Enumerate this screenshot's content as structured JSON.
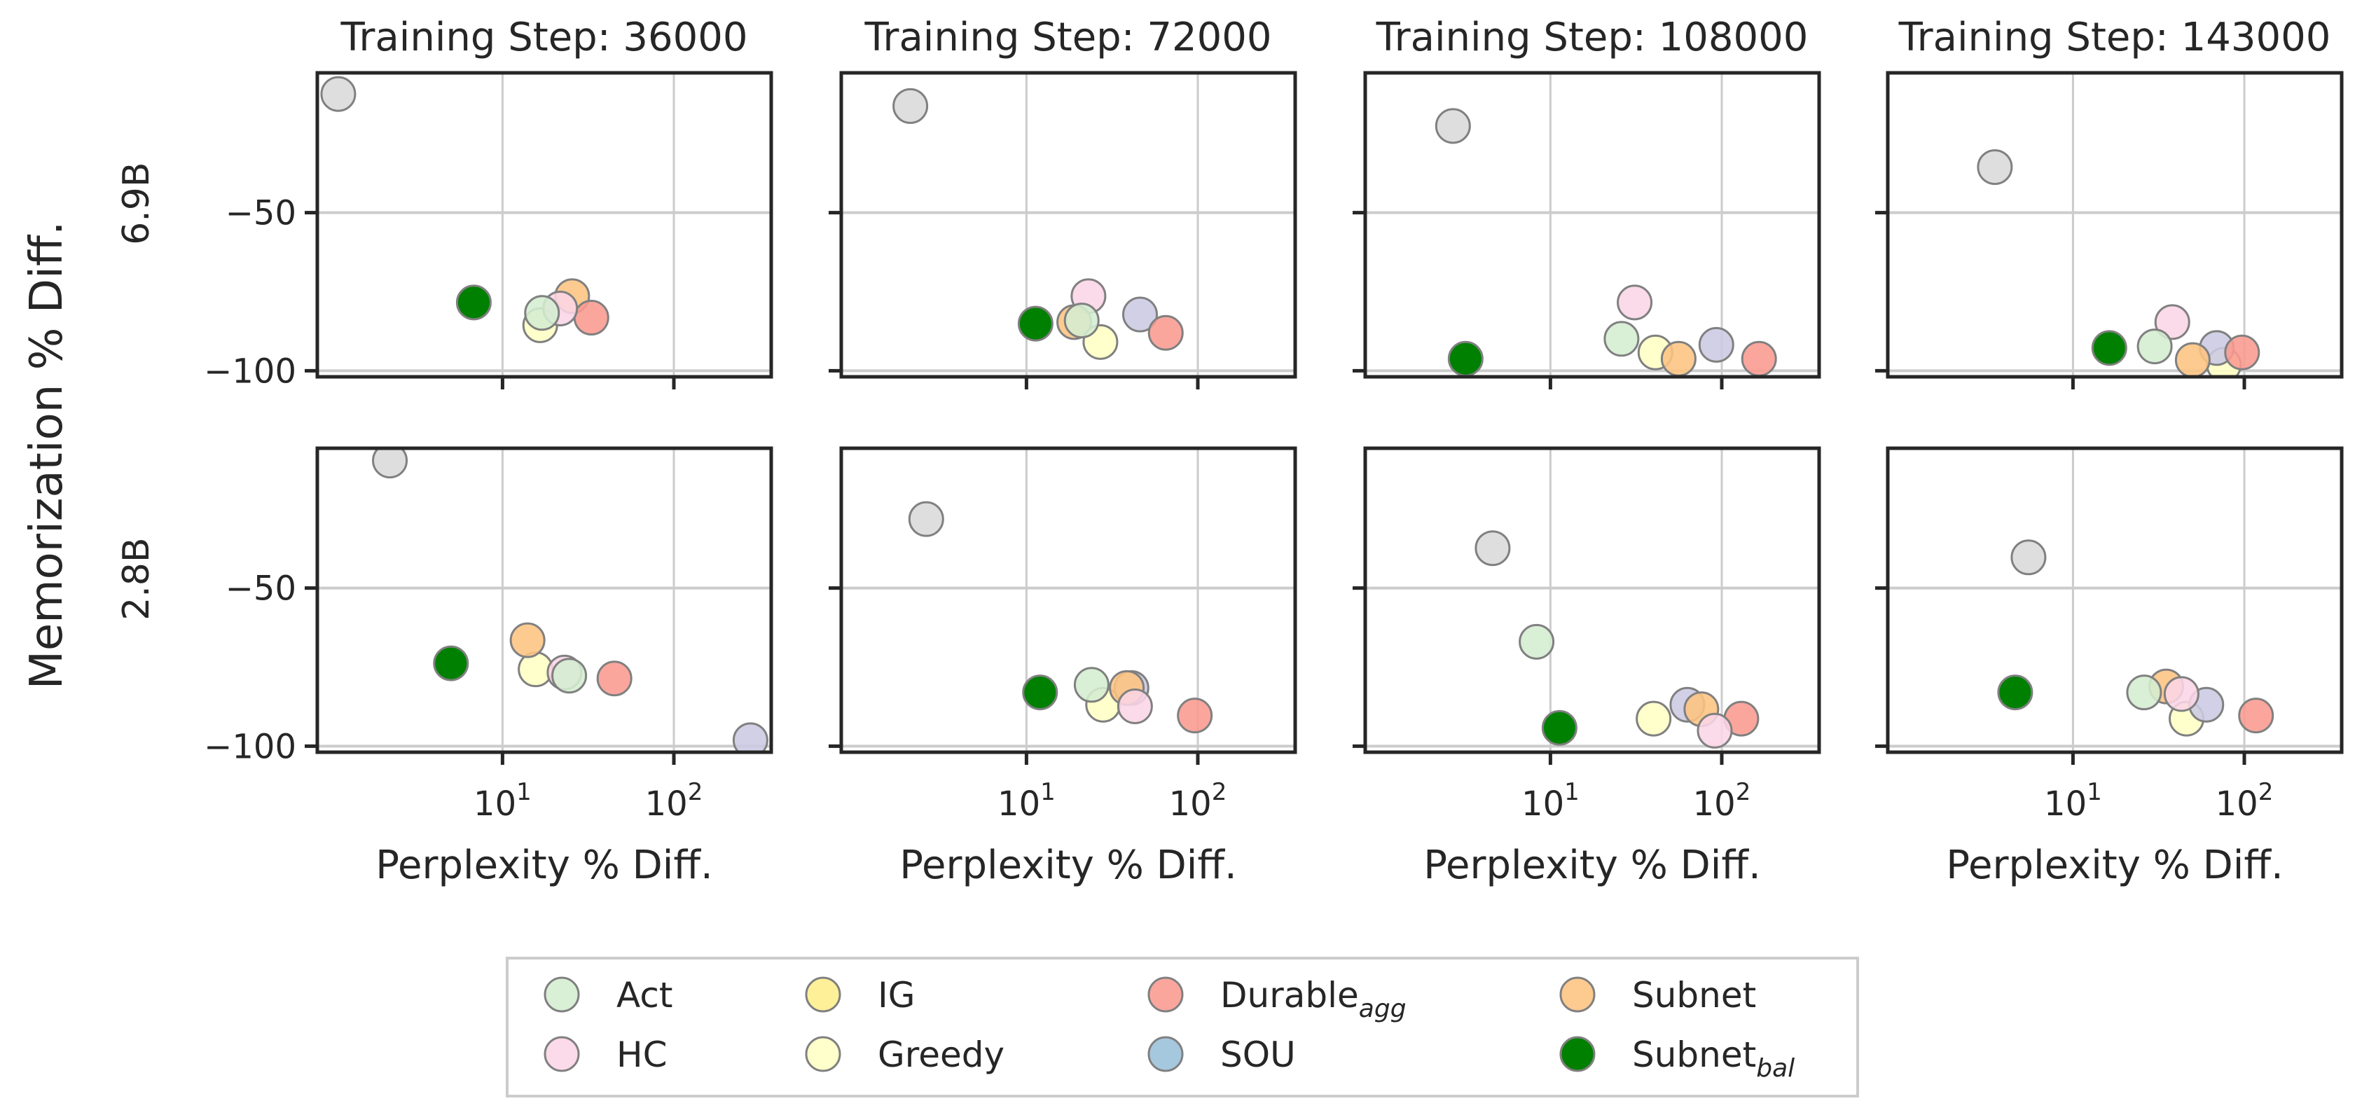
{
  "chart_data": {
    "type": "scatter",
    "y_super_label": "Memorization % Diff.",
    "xlabel": "Perplexity % Diff.",
    "x_scale": "log",
    "xlim": [
      0.83,
      370
    ],
    "ylim": [
      -101.9,
      -5.8
    ],
    "x_ticks": [
      {
        "value": 10,
        "base": "10",
        "exp": "1"
      },
      {
        "value": 100,
        "base": "10",
        "exp": "2"
      }
    ],
    "y_ticks": [
      {
        "value": -50,
        "label": "−50"
      },
      {
        "value": -100,
        "label": "−100"
      }
    ],
    "grid": true,
    "legend_position": "bottom-center",
    "methods": [
      {
        "key": "act",
        "label": "Act",
        "sub": "",
        "color": "#d4edd0"
      },
      {
        "key": "hc",
        "label": "HC",
        "sub": "",
        "color": "#fbd5e6"
      },
      {
        "key": "ig",
        "label": "IG",
        "sub": "",
        "color": "#feee8b"
      },
      {
        "key": "greedy",
        "label": "Greedy",
        "sub": "",
        "color": "#ffffc4"
      },
      {
        "key": "durable",
        "label": "Durable",
        "sub": "agg",
        "color": "#fb9a8f"
      },
      {
        "key": "sou",
        "label": "SOU",
        "sub": "",
        "color": "#9ac0da"
      },
      {
        "key": "subnet",
        "label": "Subnet",
        "sub": "",
        "color": "#fdc381"
      },
      {
        "key": "subnet_bal",
        "label": "Subnet",
        "sub": "bal",
        "color": "#008000"
      }
    ],
    "unlabeled_series_colors": {
      "grey": "#d9d9d9",
      "lavender": "#cbc9e2"
    },
    "rows": [
      {
        "label": "6.9B"
      },
      {
        "label": "2.8B"
      }
    ],
    "columns": [
      {
        "title": "Training Step: 36000"
      },
      {
        "title": "Training Step: 72000"
      },
      {
        "title": "Training Step: 108000"
      },
      {
        "title": "Training Step: 143000"
      }
    ],
    "panels": [
      {
        "row": 0,
        "col": 0,
        "points": [
          {
            "series": "grey",
            "x": 1.1,
            "y": -12.5
          },
          {
            "series": "subnet_bal",
            "x": 6.8,
            "y": -78.4
          },
          {
            "series": "greedy",
            "x": 16.6,
            "y": -85.6
          },
          {
            "series": "subnet",
            "x": 25.5,
            "y": -76.4
          },
          {
            "series": "durable",
            "x": 33,
            "y": -83.2
          },
          {
            "series": "hc",
            "x": 21.7,
            "y": -80.3
          },
          {
            "series": "act",
            "x": 17,
            "y": -81.7
          }
        ]
      },
      {
        "row": 0,
        "col": 1,
        "points": [
          {
            "series": "grey",
            "x": 2.1,
            "y": -16.3
          },
          {
            "series": "subnet_bal",
            "x": 11.3,
            "y": -85.1
          },
          {
            "series": "hc",
            "x": 23,
            "y": -76.4
          },
          {
            "series": "subnet",
            "x": 19,
            "y": -84.6
          },
          {
            "series": "greedy",
            "x": 27,
            "y": -90.9
          },
          {
            "series": "act",
            "x": 21,
            "y": -84.1
          },
          {
            "series": "lavender",
            "x": 46,
            "y": -82.2
          },
          {
            "series": "durable",
            "x": 65,
            "y": -88.0
          }
        ]
      },
      {
        "row": 0,
        "col": 2,
        "points": [
          {
            "series": "grey",
            "x": 2.7,
            "y": -22.6
          },
          {
            "series": "subnet_bal",
            "x": 3.2,
            "y": -96.2
          },
          {
            "series": "hc",
            "x": 31,
            "y": -78.4
          },
          {
            "series": "act",
            "x": 26,
            "y": -89.9
          },
          {
            "series": "greedy",
            "x": 41,
            "y": -94.2
          },
          {
            "series": "subnet",
            "x": 56,
            "y": -96.2
          },
          {
            "series": "lavender",
            "x": 93,
            "y": -91.8
          },
          {
            "series": "durable",
            "x": 165,
            "y": -96.2
          }
        ]
      },
      {
        "row": 0,
        "col": 3,
        "points": [
          {
            "series": "grey",
            "x": 3.5,
            "y": -35.6
          },
          {
            "series": "subnet_bal",
            "x": 16.3,
            "y": -92.8
          },
          {
            "series": "hc",
            "x": 38,
            "y": -84.6
          },
          {
            "series": "act",
            "x": 30,
            "y": -92.3
          },
          {
            "series": "greedy",
            "x": 76,
            "y": -98.1
          },
          {
            "series": "lavender",
            "x": 69,
            "y": -92.8
          },
          {
            "series": "subnet",
            "x": 50,
            "y": -96.6
          },
          {
            "series": "durable",
            "x": 97,
            "y": -94.2
          }
        ]
      },
      {
        "row": 1,
        "col": 0,
        "points": [
          {
            "series": "grey",
            "x": 2.2,
            "y": -9.7
          },
          {
            "series": "subnet_bal",
            "x": 5.0,
            "y": -73.8
          },
          {
            "series": "greedy",
            "x": 15.6,
            "y": -75.7
          },
          {
            "series": "subnet",
            "x": 14,
            "y": -66.5
          },
          {
            "series": "hc",
            "x": 23,
            "y": -76.7
          },
          {
            "series": "act",
            "x": 24.5,
            "y": -77.7
          },
          {
            "series": "durable",
            "x": 45,
            "y": -78.6
          },
          {
            "series": "lavender",
            "x": 280,
            "y": -98.1
          }
        ]
      },
      {
        "row": 1,
        "col": 1,
        "points": [
          {
            "series": "grey",
            "x": 2.6,
            "y": -28.2
          },
          {
            "series": "subnet_bal",
            "x": 12,
            "y": -83.0
          },
          {
            "series": "greedy",
            "x": 28,
            "y": -86.9
          },
          {
            "series": "act",
            "x": 24,
            "y": -80.6
          },
          {
            "series": "lavender",
            "x": 41,
            "y": -81.6
          },
          {
            "series": "subnet",
            "x": 38.5,
            "y": -81.6
          },
          {
            "series": "hc",
            "x": 43,
            "y": -87.4
          },
          {
            "series": "durable",
            "x": 96,
            "y": -90.3
          }
        ]
      },
      {
        "row": 1,
        "col": 2,
        "points": [
          {
            "series": "grey",
            "x": 4.6,
            "y": -37.4
          },
          {
            "series": "act",
            "x": 8.3,
            "y": -67.0
          },
          {
            "series": "subnet_bal",
            "x": 11.3,
            "y": -94.2
          },
          {
            "series": "greedy",
            "x": 40,
            "y": -91.3
          },
          {
            "series": "lavender",
            "x": 63,
            "y": -86.9
          },
          {
            "series": "subnet",
            "x": 76,
            "y": -88.3
          },
          {
            "series": "durable",
            "x": 130,
            "y": -91.3
          },
          {
            "series": "hc",
            "x": 91,
            "y": -95.1
          }
        ]
      },
      {
        "row": 1,
        "col": 3,
        "points": [
          {
            "series": "grey",
            "x": 5.5,
            "y": -40.3
          },
          {
            "series": "subnet_bal",
            "x": 4.6,
            "y": -83.0
          },
          {
            "series": "subnet",
            "x": 35,
            "y": -81.1
          },
          {
            "series": "act",
            "x": 26,
            "y": -83.0
          },
          {
            "series": "greedy",
            "x": 46,
            "y": -91.3
          },
          {
            "series": "lavender",
            "x": 60,
            "y": -86.9
          },
          {
            "series": "hc",
            "x": 43,
            "y": -83.5
          },
          {
            "series": "durable",
            "x": 117,
            "y": -90.3
          }
        ]
      }
    ]
  }
}
